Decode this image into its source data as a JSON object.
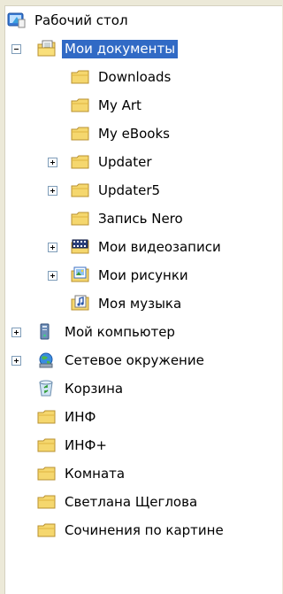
{
  "tree": {
    "root": {
      "label": "Рабочий стол",
      "icon": "desktop-icon"
    },
    "my_documents": {
      "label": "Мои документы",
      "icon": "my-documents-folder-icon",
      "expanded": true,
      "selected": true,
      "children": [
        {
          "label": "Downloads",
          "icon": "folder-icon",
          "expander": "none"
        },
        {
          "label": "My Art",
          "icon": "folder-icon",
          "expander": "none"
        },
        {
          "label": "My eBooks",
          "icon": "folder-icon",
          "expander": "none"
        },
        {
          "label": "Updater",
          "icon": "folder-icon",
          "expander": "plus"
        },
        {
          "label": "Updater5",
          "icon": "folder-icon",
          "expander": "plus"
        },
        {
          "label": "Запись Nero",
          "icon": "folder-icon",
          "expander": "none"
        },
        {
          "label": "Мои видеозаписи",
          "icon": "video-folder-icon",
          "expander": "plus"
        },
        {
          "label": "Мои рисунки",
          "icon": "pictures-folder-icon",
          "expander": "plus"
        },
        {
          "label": "Моя музыка",
          "icon": "music-folder-icon",
          "expander": "none"
        }
      ]
    },
    "top_level": [
      {
        "label": "Мой компьютер",
        "icon": "my-computer-icon",
        "expander": "plus"
      },
      {
        "label": "Сетевое окружение",
        "icon": "network-icon",
        "expander": "plus"
      },
      {
        "label": "Корзина",
        "icon": "recycle-bin-icon",
        "expander": "none"
      },
      {
        "label": "ИНФ",
        "icon": "folder-icon",
        "expander": "none"
      },
      {
        "label": "ИНФ+",
        "icon": "folder-icon",
        "expander": "none"
      },
      {
        "label": "Комната",
        "icon": "folder-icon",
        "expander": "none"
      },
      {
        "label": "Светлана Щеглова",
        "icon": "folder-icon",
        "expander": "none"
      },
      {
        "label": "Сочинения по картине",
        "icon": "folder-icon",
        "expander": "none"
      }
    ]
  },
  "colors": {
    "selection": "#316ac5",
    "background": "#ece9d8",
    "folder": "#f5d76e"
  }
}
